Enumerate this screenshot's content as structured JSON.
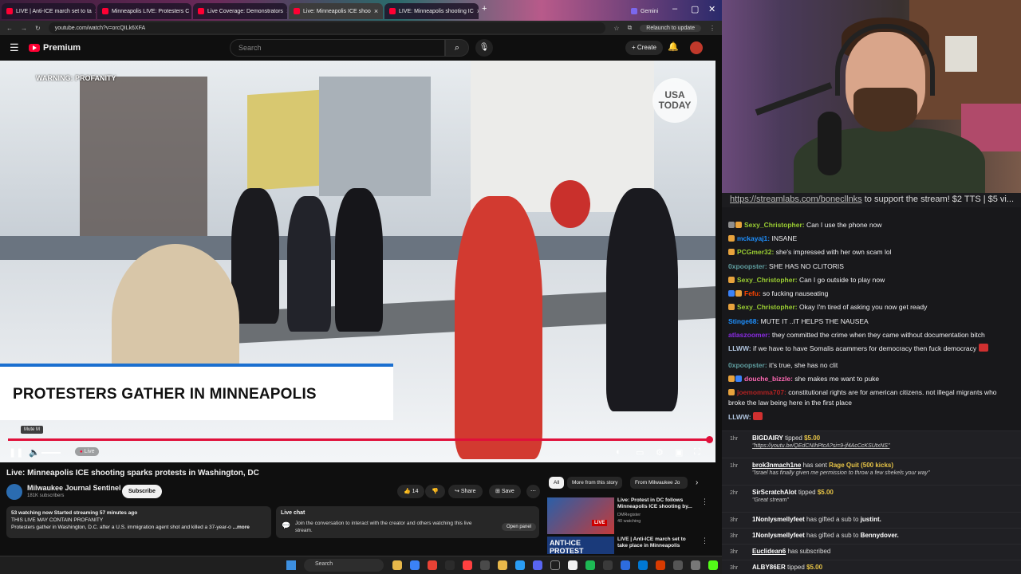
{
  "browser": {
    "tabs": [
      {
        "title": "LIVE | Anti-ICE march set to ta",
        "active": false
      },
      {
        "title": "Minneapolis LIVE: Protesters C",
        "active": false
      },
      {
        "title": "Live Coverage: Demonstrators",
        "active": false
      },
      {
        "title": "Live: Minneapolis ICE shoo",
        "active": true
      },
      {
        "title": "LIVE: Minneapolis shooting IC",
        "active": false
      },
      {
        "title": "Gemini",
        "active": false
      }
    ],
    "url": "youtube.com/watch?v=orcQILk6XFA",
    "relaunch_label": "Relaunch to update"
  },
  "youtube": {
    "brand": "Premium",
    "search_placeholder": "Search",
    "create_label": "Create",
    "player": {
      "warning": "WARNING: PROFANITY",
      "watermark": "USA TODAY",
      "lower_third": "PROTESTERS GATHER IN MINNEAPOLIS",
      "mute_tooltip": "Mute  M",
      "live_label": "Live"
    },
    "video_title": "Live: Minneapolis ICE shooting sparks protests in Washington, DC",
    "channel": {
      "name": "Milwaukee Journal Sentinel",
      "subs": "181K subscribers",
      "subscribe_label": "Subscribe"
    },
    "actions": {
      "likes": "14",
      "share": "Share",
      "save": "Save"
    },
    "description": {
      "line1": "53 watching now  Started streaming 57 minutes ago",
      "line2": "THIS LIVE MAY CONTAIN PROFANITY",
      "line3": "Protesters gather in Washington, D.C. after a U.S. immigration agent shot and killed a 37-year-o",
      "more": "...more"
    },
    "live_chat": {
      "heading": "Live chat",
      "body": "Join the conversation to interact with the creator and others watching this live stream.",
      "open_panel": "Open panel"
    },
    "chips": [
      "All",
      "More from this story",
      "From Milwaukee Jo"
    ],
    "recommendations": [
      {
        "title": "Live: Protest in DC follows Minneapolis ICE shooting by...",
        "channel": "DMRegister",
        "meta": "40 watching",
        "thumb_text": "LIVE"
      },
      {
        "title": "LIVE | Anti-ICE march set to take place in Minneapolis",
        "channel": "",
        "meta": "",
        "thumb_text": "ANTI-ICE PROTEST"
      }
    ]
  },
  "taskbar": {
    "search_label": "Search"
  },
  "stream_chat": {
    "banner_link": "https://streamlabs.com/bonecllnks",
    "banner_text": "to support the stream! $2 TTS | $5 vi...",
    "messages": [
      {
        "user": "Sexy_Christopher:",
        "text": "Can I use the phone now",
        "color": "#9acd32"
      },
      {
        "user": "mckayaj1:",
        "text": "INSANE",
        "color": "#1e90ff"
      },
      {
        "user": "PCGmer32:",
        "text": "she's impressed with her own scam lol",
        "color": "#9acd32"
      },
      {
        "user": "0xpoopster:",
        "text": "SHE HAS NO CLITORIS",
        "color": "#5f9ea0"
      },
      {
        "user": "Sexy_Christopher:",
        "text": "Can I go outside to play now",
        "color": "#9acd32"
      },
      {
        "user": "Fefu:",
        "text": "so fucking nauseating",
        "color": "#ff4500"
      },
      {
        "user": "Sexy_Christopher:",
        "text": "Okay I'm tired of asking you now get ready",
        "color": "#9acd32"
      },
      {
        "user": "Stinge68:",
        "text": "MUTE IT ..IT HELPS THE NAUSEA",
        "color": "#1e90ff"
      },
      {
        "user": "atlaszoomer:",
        "text": "they committed the crime when they came without documentation bitch",
        "color": "#8a2be2"
      },
      {
        "user": "LLWW:",
        "text": "if we have to have Somalis acammers for democracy then fuck democracy",
        "color": "#b0c4de"
      },
      {
        "user": "0xpoopster:",
        "text": "it's true, she has no clit",
        "color": "#5f9ea0"
      },
      {
        "user": "douche_bizzle:",
        "text": "she makes me want to puke",
        "color": "#ff69b4"
      },
      {
        "user": "joemomma707:",
        "text": "constitutional rights are for american citizens. not illegal migrants who broke the law being here in the first place",
        "color": "#b22222"
      },
      {
        "user": "LLWW:",
        "text": "",
        "color": "#b0c4de"
      }
    ],
    "events": [
      {
        "time": "1hr",
        "line1_user": "BIGDAIRY",
        "line1_rest": "tipped",
        "amount": "$5.00",
        "line2": "\"https://youtu.be/QEdCNIhPtcA?si=9-jf4AcCcKSUtxNS\""
      },
      {
        "time": "1hr",
        "line1_user": "brok3nmach1ne",
        "line1_rest": "has sent",
        "amount": "Rage Quit (500 kicks)",
        "line2": "\"Israel has finally given me permission to throw a few shekels your way\""
      },
      {
        "time": "2hr",
        "line1_user": "SirScratchAlot",
        "line1_rest": "tipped",
        "amount": "$5.00",
        "line2": "\"Great stream\""
      },
      {
        "time": "3hr",
        "line1_user": "1Nonlysmellyfeet",
        "line1_rest": "has gifted a sub to",
        "amount": "justint.",
        "line2": ""
      },
      {
        "time": "3hr",
        "line1_user": "1Nonlysmellyfeet",
        "line1_rest": "has gifted a sub to",
        "amount": "Bennydover.",
        "line2": ""
      },
      {
        "time": "3hr",
        "line1_user": "Euclidean6",
        "line1_rest": "has subscribed",
        "amount": "",
        "line2": ""
      },
      {
        "time": "3hr",
        "line1_user": "ALBY86ER",
        "line1_rest": "tipped",
        "amount": "$5.00",
        "line2": ""
      }
    ]
  }
}
